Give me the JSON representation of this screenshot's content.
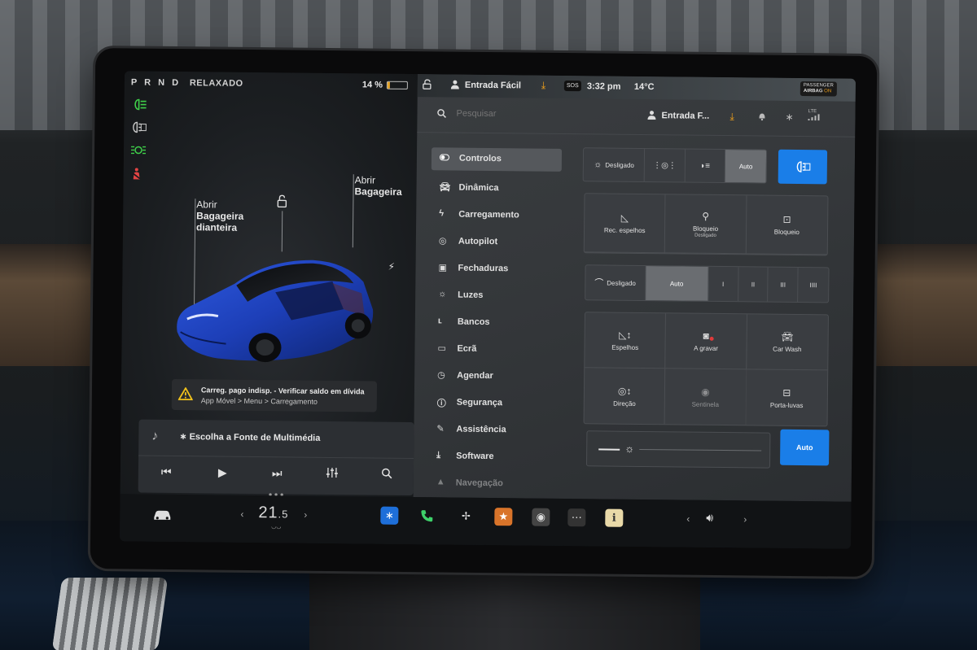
{
  "car_panel": {
    "gear": "P R N D",
    "drive_mode": "RELAXADO",
    "battery_pct": "14 %",
    "battery_level": 0.14,
    "callout_frunk": {
      "line1": "Abrir",
      "line2": "Bagageira",
      "line3": "dianteira"
    },
    "callout_trunk": {
      "line1": "Abrir",
      "line2": "Bagageira"
    },
    "warning": {
      "title": "Carreg. pago indisp. - Verificar saldo em dívida",
      "detail": "App Móvel > Menu > Carregamento"
    }
  },
  "media": {
    "source_label": "Escolha a Fonte de Multimédia",
    "bluetooth_glyph": "∗",
    "icons": [
      "music-note-icon",
      "previous-icon",
      "play-icon",
      "next-icon",
      "equalizer-icon",
      "search-icon"
    ]
  },
  "status_bar": {
    "profile": "Entrada Fácil",
    "sos": "SOS",
    "time": "3:32 pm",
    "temperature": "14°C",
    "airbag_line1": "PASSENGER",
    "airbag_line2": "AIRBAG",
    "airbag_state": "ON"
  },
  "search": {
    "placeholder": "Pesquisar",
    "profile_short": "Entrada F...",
    "lte": "LTE"
  },
  "nav": {
    "items": [
      {
        "label": "Controlos",
        "icon": "toggle-icon"
      },
      {
        "label": "Dinâmica",
        "icon": "car-icon"
      },
      {
        "label": "Carregamento",
        "icon": "bolt-icon"
      },
      {
        "label": "Autopilot",
        "icon": "steering-wheel-icon"
      },
      {
        "label": "Fechaduras",
        "icon": "lock-icon"
      },
      {
        "label": "Luzes",
        "icon": "sun-icon"
      },
      {
        "label": "Bancos",
        "icon": "seat-icon"
      },
      {
        "label": "Ecrã",
        "icon": "display-icon"
      },
      {
        "label": "Agendar",
        "icon": "clock-icon"
      },
      {
        "label": "Segurança",
        "icon": "shield-icon"
      },
      {
        "label": "Assistência",
        "icon": "wrench-icon"
      },
      {
        "label": "Software",
        "icon": "download-icon"
      },
      {
        "label": "Navegação",
        "icon": "navigation-icon"
      }
    ]
  },
  "controls": {
    "lights": {
      "off": "Desligado",
      "auto": "Auto"
    },
    "mirrors_row": {
      "fold": "Rec. espelhos",
      "childlock": "Bloqueio",
      "childlock_sub": "Desligado",
      "windowlock": "Bloqueio"
    },
    "wipers": {
      "off": "Desligado",
      "auto": "Auto",
      "speeds": [
        "I",
        "II",
        "III",
        "IIII"
      ]
    },
    "tiles": {
      "mirrors": "Espelhos",
      "recording": "A gravar",
      "carwash": "Car Wash",
      "steering": "Direção",
      "sentry": "Sentinela",
      "glovebox": "Porta-luvas"
    },
    "brightness_auto": "Auto"
  },
  "dock": {
    "cabin_temp": "21",
    "cabin_temp_decimal": ".5",
    "apps": [
      "bluetooth-icon",
      "phone-icon",
      "fan-icon",
      "toybox-icon",
      "camera-icon",
      "more-icon",
      "notepad-icon"
    ]
  },
  "colors": {
    "accent_blue": "#1a7ee8",
    "warning_yellow": "#f1c21b",
    "download_orange": "#f1a11b",
    "light_green": "#3fd04a",
    "alert_red": "#e24444"
  }
}
